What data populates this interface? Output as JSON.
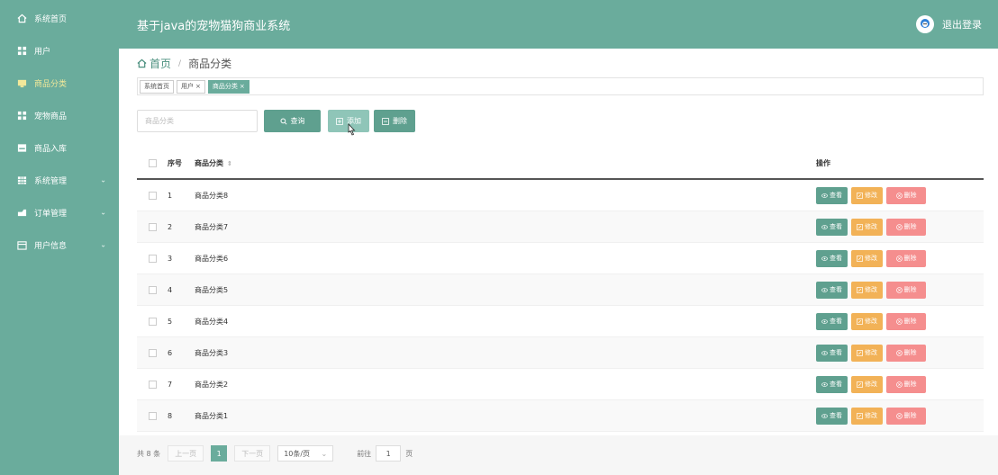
{
  "header": {
    "app_title": "基于java的宠物猫狗商业系统",
    "logout_label": "退出登录"
  },
  "sidebar": {
    "items": [
      {
        "label": "系统首页",
        "icon": "home-icon"
      },
      {
        "label": "用户",
        "icon": "grid-icon"
      },
      {
        "label": "商品分类",
        "icon": "folder-icon"
      },
      {
        "label": "宠物商品",
        "icon": "grid-icon"
      },
      {
        "label": "商品入库",
        "icon": "box-icon"
      },
      {
        "label": "系统管理",
        "icon": "table-icon"
      },
      {
        "label": "订单管理",
        "icon": "cart-icon"
      },
      {
        "label": "用户信息",
        "icon": "calendar-icon"
      }
    ]
  },
  "breadcrumb": {
    "home": "首页",
    "separator": "/",
    "current": "商品分类"
  },
  "tags": [
    {
      "label": "系统首页",
      "closable": false
    },
    {
      "label": "用户",
      "closable": true
    },
    {
      "label": "商品分类",
      "closable": true
    }
  ],
  "search": {
    "placeholder": "商品分类"
  },
  "toolbar": {
    "search_label": "查询",
    "add_label": "添加",
    "delete_label": "删除"
  },
  "table": {
    "headers": {
      "index": "序号",
      "category": "商品分类",
      "actions": "操作"
    },
    "rows": [
      {
        "index": "1",
        "category": "商品分类8"
      },
      {
        "index": "2",
        "category": "商品分类7"
      },
      {
        "index": "3",
        "category": "商品分类6"
      },
      {
        "index": "4",
        "category": "商品分类5"
      },
      {
        "index": "5",
        "category": "商品分类4"
      },
      {
        "index": "6",
        "category": "商品分类3"
      },
      {
        "index": "7",
        "category": "商品分类2"
      },
      {
        "index": "8",
        "category": "商品分类1"
      }
    ],
    "actions": {
      "view": "查看",
      "edit": "修改",
      "delete": "删除"
    }
  },
  "pagination": {
    "total_text": "共 8 条",
    "prev": "上一页",
    "current_page": "1",
    "next": "下一页",
    "page_size": "10条/页",
    "goto_label": "前往",
    "goto_value": "1",
    "page_unit": "页"
  },
  "colors": {
    "brand": "#6aac9c",
    "view": "#5fa08f",
    "edit": "#f2b257",
    "delete": "#f58e8e"
  }
}
